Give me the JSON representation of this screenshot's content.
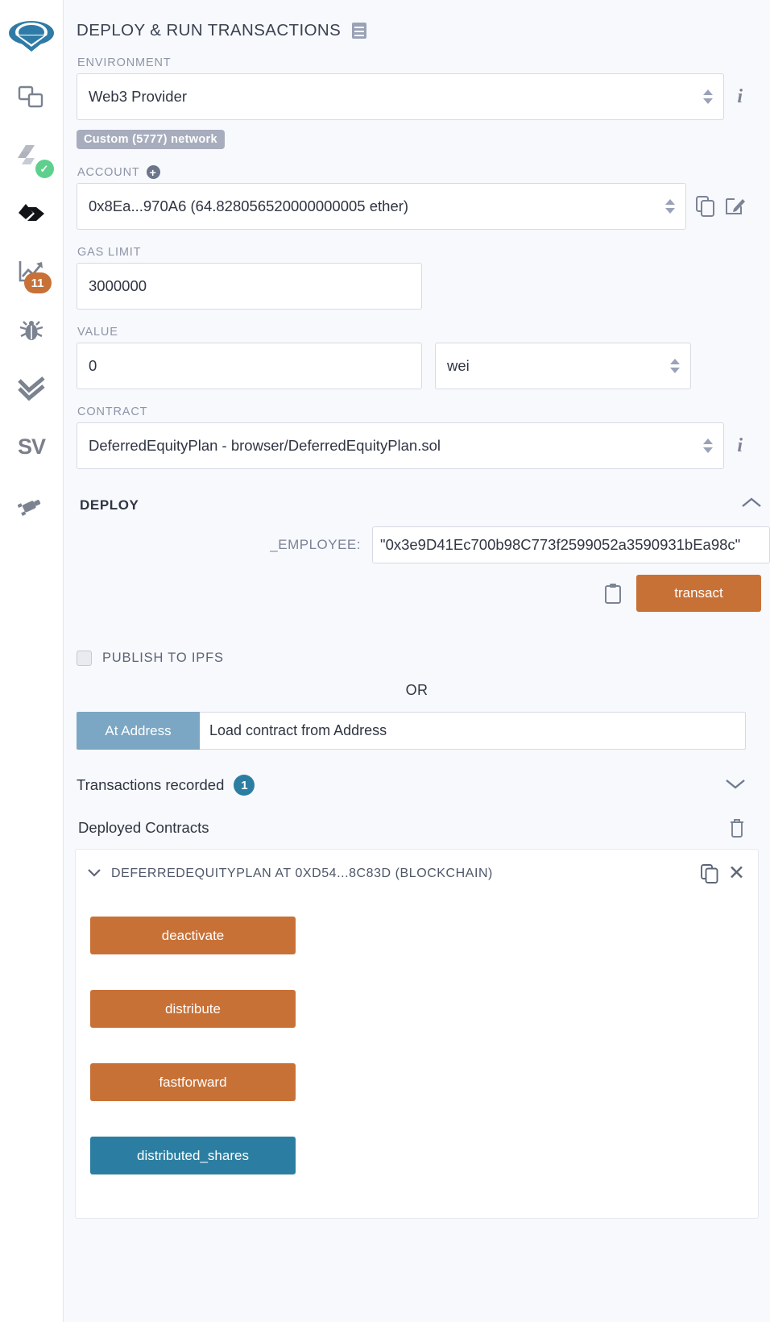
{
  "rail": {
    "items": [
      {
        "name": "remix-logo",
        "icon": "remix-logo-icon"
      },
      {
        "name": "file-explorer",
        "icon": "files-icon"
      },
      {
        "name": "solidity-compiler",
        "icon": "solidity-icon",
        "badge": "✓"
      },
      {
        "name": "deploy-run-transactions",
        "icon": "deploy-icon"
      },
      {
        "name": "analysis",
        "icon": "chart-icon",
        "badge": "11"
      },
      {
        "name": "debugger",
        "icon": "bug-icon"
      },
      {
        "name": "unit-testing",
        "icon": "double-check-icon"
      },
      {
        "name": "solidity-unit-testing",
        "icon": "sv-icon",
        "label": "SV"
      },
      {
        "name": "plugin-manager",
        "icon": "plug-icon"
      }
    ]
  },
  "header": {
    "title": "DEPLOY & RUN TRANSACTIONS",
    "doc_icon": "book-icon"
  },
  "environment": {
    "label": "ENVIRONMENT",
    "value": "Web3 Provider",
    "network_badge": "Custom (5777) network",
    "info_icon": "info-icon"
  },
  "account": {
    "label": "ACCOUNT",
    "add_icon": "plus-circle-icon",
    "value": "0x8Ea...970A6 (64.828056520000000005 ether)",
    "copy_icon": "copy-icon",
    "edit_icon": "edit-icon"
  },
  "gas_limit": {
    "label": "GAS LIMIT",
    "value": "3000000"
  },
  "value_field": {
    "label": "VALUE",
    "value": "0",
    "unit": "wei"
  },
  "contract": {
    "label": "CONTRACT",
    "value": "DeferredEquityPlan - browser/DeferredEquityPlan.sol",
    "info_icon": "info-icon"
  },
  "deploy": {
    "title": "DEPLOY",
    "collapse_icon": "chevron-up-icon",
    "param_label": "_EMPLOYEE:",
    "param_value": "\"0x3e9D41Ec700b98C773f2599052a3590931bEa98c\"",
    "clipboard_icon": "clipboard-icon",
    "transact_label": "transact"
  },
  "ipfs": {
    "label": "PUBLISH TO IPFS",
    "checked": false
  },
  "or_text": "OR",
  "at_address": {
    "button_label": "At Address",
    "placeholder": "Load contract from Address"
  },
  "transactions_recorded": {
    "label": "Transactions recorded",
    "count": "1",
    "expand_icon": "chevron-down-icon"
  },
  "deployed_contracts": {
    "title": "Deployed Contracts",
    "trash_icon": "trash-icon",
    "card": {
      "expand_icon": "chevron-down-icon",
      "title": "DEFERREDEQUITYPLAN AT 0XD54...8C83D (BLOCKCHAIN)",
      "copy_icon": "copy-icon",
      "close_icon": "close-icon",
      "functions": [
        {
          "label": "deactivate",
          "kind": "tx"
        },
        {
          "label": "distribute",
          "kind": "tx"
        },
        {
          "label": "fastforward",
          "kind": "tx"
        },
        {
          "label": "distributed_shares",
          "kind": "call"
        }
      ]
    }
  },
  "colors": {
    "transact_orange": "#c87137",
    "call_blue": "#2b7ea1",
    "at_address_blue": "#7ba7c4",
    "badge_gray": "#a7adbd",
    "check_green": "#5fcf8e",
    "panel_bg": "#f8f9fc"
  }
}
